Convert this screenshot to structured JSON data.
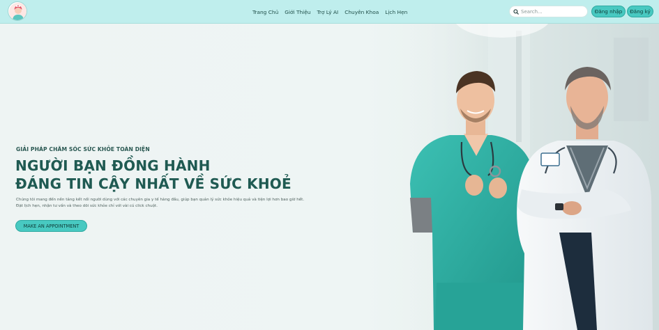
{
  "header": {
    "logo_name": "doctor-logo-icon",
    "nav": [
      {
        "label": "Trang Chủ"
      },
      {
        "label": "Giới Thiệu"
      },
      {
        "label": "Trợ Lý AI"
      },
      {
        "label": "Chuyên Khoa"
      },
      {
        "label": "Lịch Hẹn"
      }
    ],
    "search": {
      "placeholder": "Search...",
      "value": ""
    },
    "login_label": "Đăng nhập",
    "register_label": "Đăng ký"
  },
  "hero": {
    "tagline": "GIẢI PHÁP CHĂM SÓC SỨC KHỎE TOÀN DIỆN",
    "heading_line1": "NGƯỜI BẠN ĐỒNG HÀNH",
    "heading_line2": "ĐÁNG TIN CẬY NHẤT VỀ SỨC KHOẺ",
    "description_line1": "Chúng tôi mang đến nền tảng kết nối người dùng với các chuyên gia y tế hàng đầu, giúp bạn quản lý sức khỏe hiệu quả và tiện lợi hơn bao giờ hết.",
    "description_line2": "Đặt lịch hẹn, nhận tư vấn và theo dõi sức khỏe chỉ với vài cú click chuột.",
    "cta_label": "MAKE AN APPOINTMENT"
  },
  "colors": {
    "header_bg": "#bfeeed",
    "accent": "#48c9c1",
    "heading": "#1f5a52",
    "scrub_teal": "#2fb3a6",
    "page_bg": "#eef4f3"
  }
}
